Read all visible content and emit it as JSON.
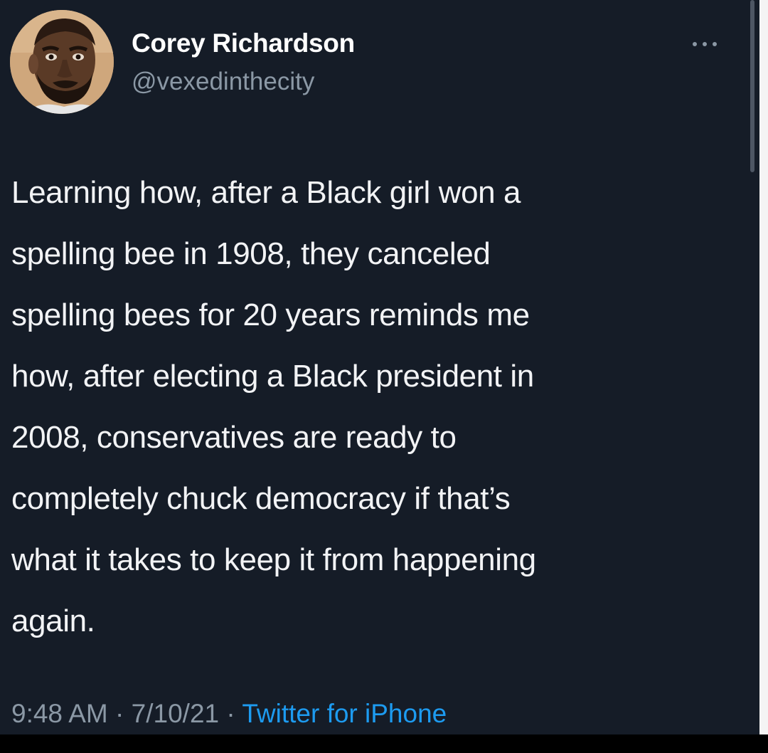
{
  "author": {
    "display_name": "Corey Richardson",
    "handle": "@vexedinthecity"
  },
  "tweet": {
    "text_lines": [
      "Learning how, after a Black girl won a",
      "spelling bee in 1908, they canceled",
      "spelling bees for 20 years reminds me",
      "how, after electing a Black president in",
      "2008, conservatives are ready to",
      "completely chuck democracy if that’s",
      "what it takes to keep it from happening",
      "again."
    ],
    "time": "9:48 AM",
    "separator": " · ",
    "date": "7/10/21",
    "source": "Twitter for iPhone"
  },
  "icons": {
    "more": "more-options-icon",
    "avatar": "profile-photo"
  },
  "colors": {
    "background": "#151c27",
    "text": "#f2f3f5",
    "secondary": "#8b98a5",
    "link": "#1d9bf0"
  }
}
